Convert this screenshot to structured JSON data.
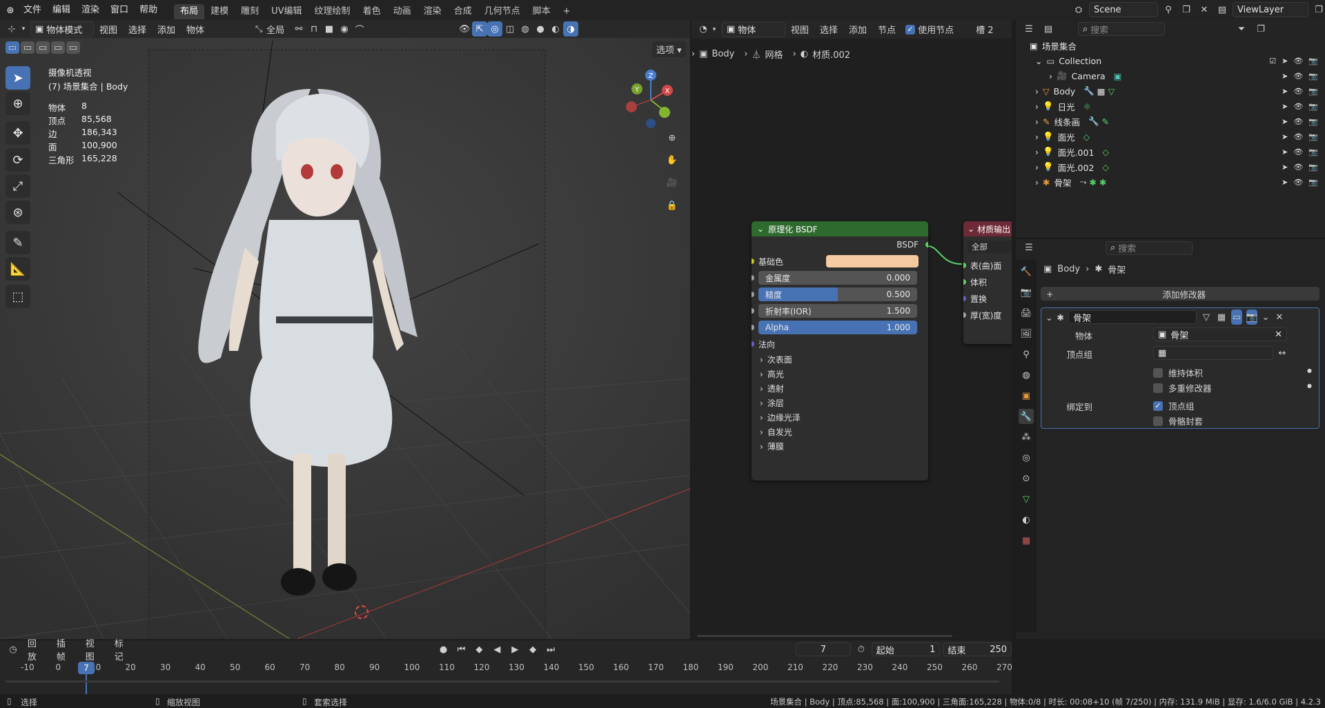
{
  "topbar": {
    "menus": [
      "文件",
      "编辑",
      "渲染",
      "窗口",
      "帮助"
    ],
    "workspaces": [
      "布局",
      "建模",
      "雕刻",
      "UV编辑",
      "纹理绘制",
      "着色",
      "动画",
      "渲染",
      "合成",
      "几何节点",
      "脚本"
    ],
    "add_tab": "+",
    "scene": "Scene",
    "view_layer": "ViewLayer"
  },
  "viewport": {
    "mode": "物体模式",
    "menus": [
      "视图",
      "选择",
      "添加",
      "物体"
    ],
    "orientation": "全局",
    "options": "选项",
    "overlay_title": "摄像机透视",
    "overlay_subtitle": "(7) 场景集合 | Body",
    "stats": [
      {
        "label": "物体",
        "value": "8"
      },
      {
        "label": "顶点",
        "value": "85,568"
      },
      {
        "label": "边",
        "value": "186,343"
      },
      {
        "label": "面",
        "value": "100,900"
      },
      {
        "label": "三角形",
        "value": "165,228"
      }
    ],
    "gizmo": {
      "z": "Z",
      "y": "Y",
      "x": "X"
    }
  },
  "node_editor": {
    "object_type": "物体",
    "menus": [
      "视图",
      "选择",
      "添加",
      "节点"
    ],
    "use_nodes": "使用节点",
    "slot": "槽 2",
    "breadcrumb": [
      "Body",
      "网格",
      "材质.002"
    ],
    "bsdf_node": {
      "title": "原理化 BSDF",
      "output": "BSDF",
      "base_color_label": "基础色",
      "base_color": "#f4caa0",
      "fields": [
        {
          "label": "金属度",
          "value": "0.000",
          "fill": 0
        },
        {
          "label": "糙度",
          "value": "0.500",
          "fill": 0.5
        },
        {
          "label": "折射率(IOR)",
          "value": "1.500",
          "fill": 0
        },
        {
          "label": "Alpha",
          "value": "1.000",
          "fill": 1
        }
      ],
      "normal": "法向",
      "panels": [
        "次表面",
        "高光",
        "透射",
        "涂层",
        "边缘光泽",
        "自发光",
        "薄膜"
      ]
    },
    "output_node": {
      "title": "材质输出",
      "target": "全部",
      "inputs": [
        "表(曲)面",
        "体积",
        "置换",
        "厚(宽)度"
      ]
    }
  },
  "outliner": {
    "search_placeholder": "搜索",
    "root": "场景集合",
    "items": [
      {
        "name": "Collection",
        "indent": 1
      },
      {
        "name": "Camera",
        "indent": 2
      },
      {
        "name": "Body",
        "indent": 1
      },
      {
        "name": "日光",
        "indent": 1
      },
      {
        "name": "线条画",
        "indent": 1
      },
      {
        "name": "面光",
        "indent": 1
      },
      {
        "name": "面光.001",
        "indent": 1
      },
      {
        "name": "面光.002",
        "indent": 1
      },
      {
        "name": "骨架",
        "indent": 1
      }
    ]
  },
  "properties": {
    "search_placeholder": "搜索",
    "breadcrumb": [
      "Body",
      "骨架"
    ],
    "add_modifier": "添加修改器",
    "modifier_name": "骨架",
    "object_label": "物体",
    "object_value": "骨架",
    "vgroup_label": "顶点组",
    "preserve_volume": "维持体积",
    "multi_modifier": "多重修改器",
    "bind_to": "绑定到",
    "vertex_groups": "顶点组",
    "bone_envelopes": "骨骼封套"
  },
  "timeline": {
    "menus": [
      "回放",
      "插帧",
      "视图",
      "标记"
    ],
    "current_frame": "7",
    "start_label": "起始",
    "start": "1",
    "end_label": "结束",
    "end": "250",
    "ticks": [
      "-10",
      "0",
      "10",
      "20",
      "30",
      "40",
      "50",
      "60",
      "70",
      "80",
      "90",
      "100",
      "110",
      "120",
      "130",
      "140",
      "150",
      "160",
      "170",
      "180",
      "190",
      "200",
      "210",
      "220",
      "230",
      "240",
      "250",
      "260",
      "270"
    ]
  },
  "statusbar": {
    "select": "选择",
    "zoom": "缩放视图",
    "lasso": "套索选择",
    "info": "场景集合 | Body | 顶点:85,568 | 面:100,900 | 三角面:165,228 | 物体:0/8 | 时长: 00:08+10 (帧 7/250) | 内存: 131.9 MiB | 显存: 1.6/6.0 GiB | 4.2.3"
  }
}
